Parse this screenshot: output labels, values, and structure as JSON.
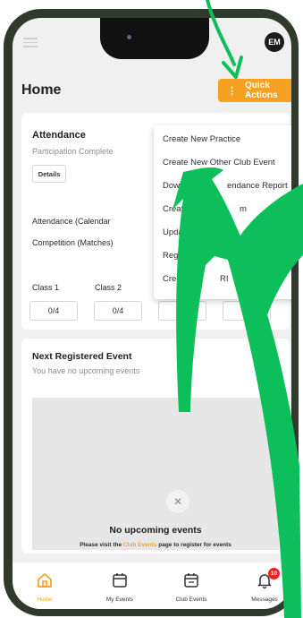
{
  "header": {
    "avatar_initials": "EM",
    "page_title": "Home"
  },
  "quick_actions": {
    "button_label": "Quick Actions",
    "menu_items": [
      "Create New Practice",
      "Create New Other Club Event",
      "Downlo",
      "endance Report",
      "Create",
      "m",
      "Updat",
      "s",
      "Regis",
      "s",
      "Create",
      "RI"
    ]
  },
  "attendance": {
    "title": "Attendance",
    "subtitle": "Participation Complete",
    "details_label": "Details",
    "calendar_line": "Attendance (Calendar",
    "competition_line": "Competition (Matches)",
    "classes": [
      {
        "label": "Class 1",
        "value": "0/4"
      },
      {
        "label": "Class 2",
        "value": "0/4"
      },
      {
        "label": "",
        "value": "4"
      },
      {
        "label": "",
        "value": "0"
      }
    ]
  },
  "next_event": {
    "title": "Next Registered Event",
    "subtitle": "You have no upcoming events",
    "empty_title": "No upcoming events",
    "note_prefix": "Please visit the ",
    "note_link": "Club Events",
    "note_suffix": " page to register for events"
  },
  "tabs": [
    {
      "label": "Home",
      "icon": "home-icon"
    },
    {
      "label": "My Events",
      "icon": "calendar-icon"
    },
    {
      "label": "Club Events",
      "icon": "club-calendar-icon"
    },
    {
      "label": "Messages",
      "icon": "bell-icon",
      "badge": "10"
    }
  ],
  "colors": {
    "accent": "#f6a121",
    "overlay_green": "#0dbf5a",
    "badge_red": "#e5261f",
    "frame": "#2f3a2c"
  }
}
